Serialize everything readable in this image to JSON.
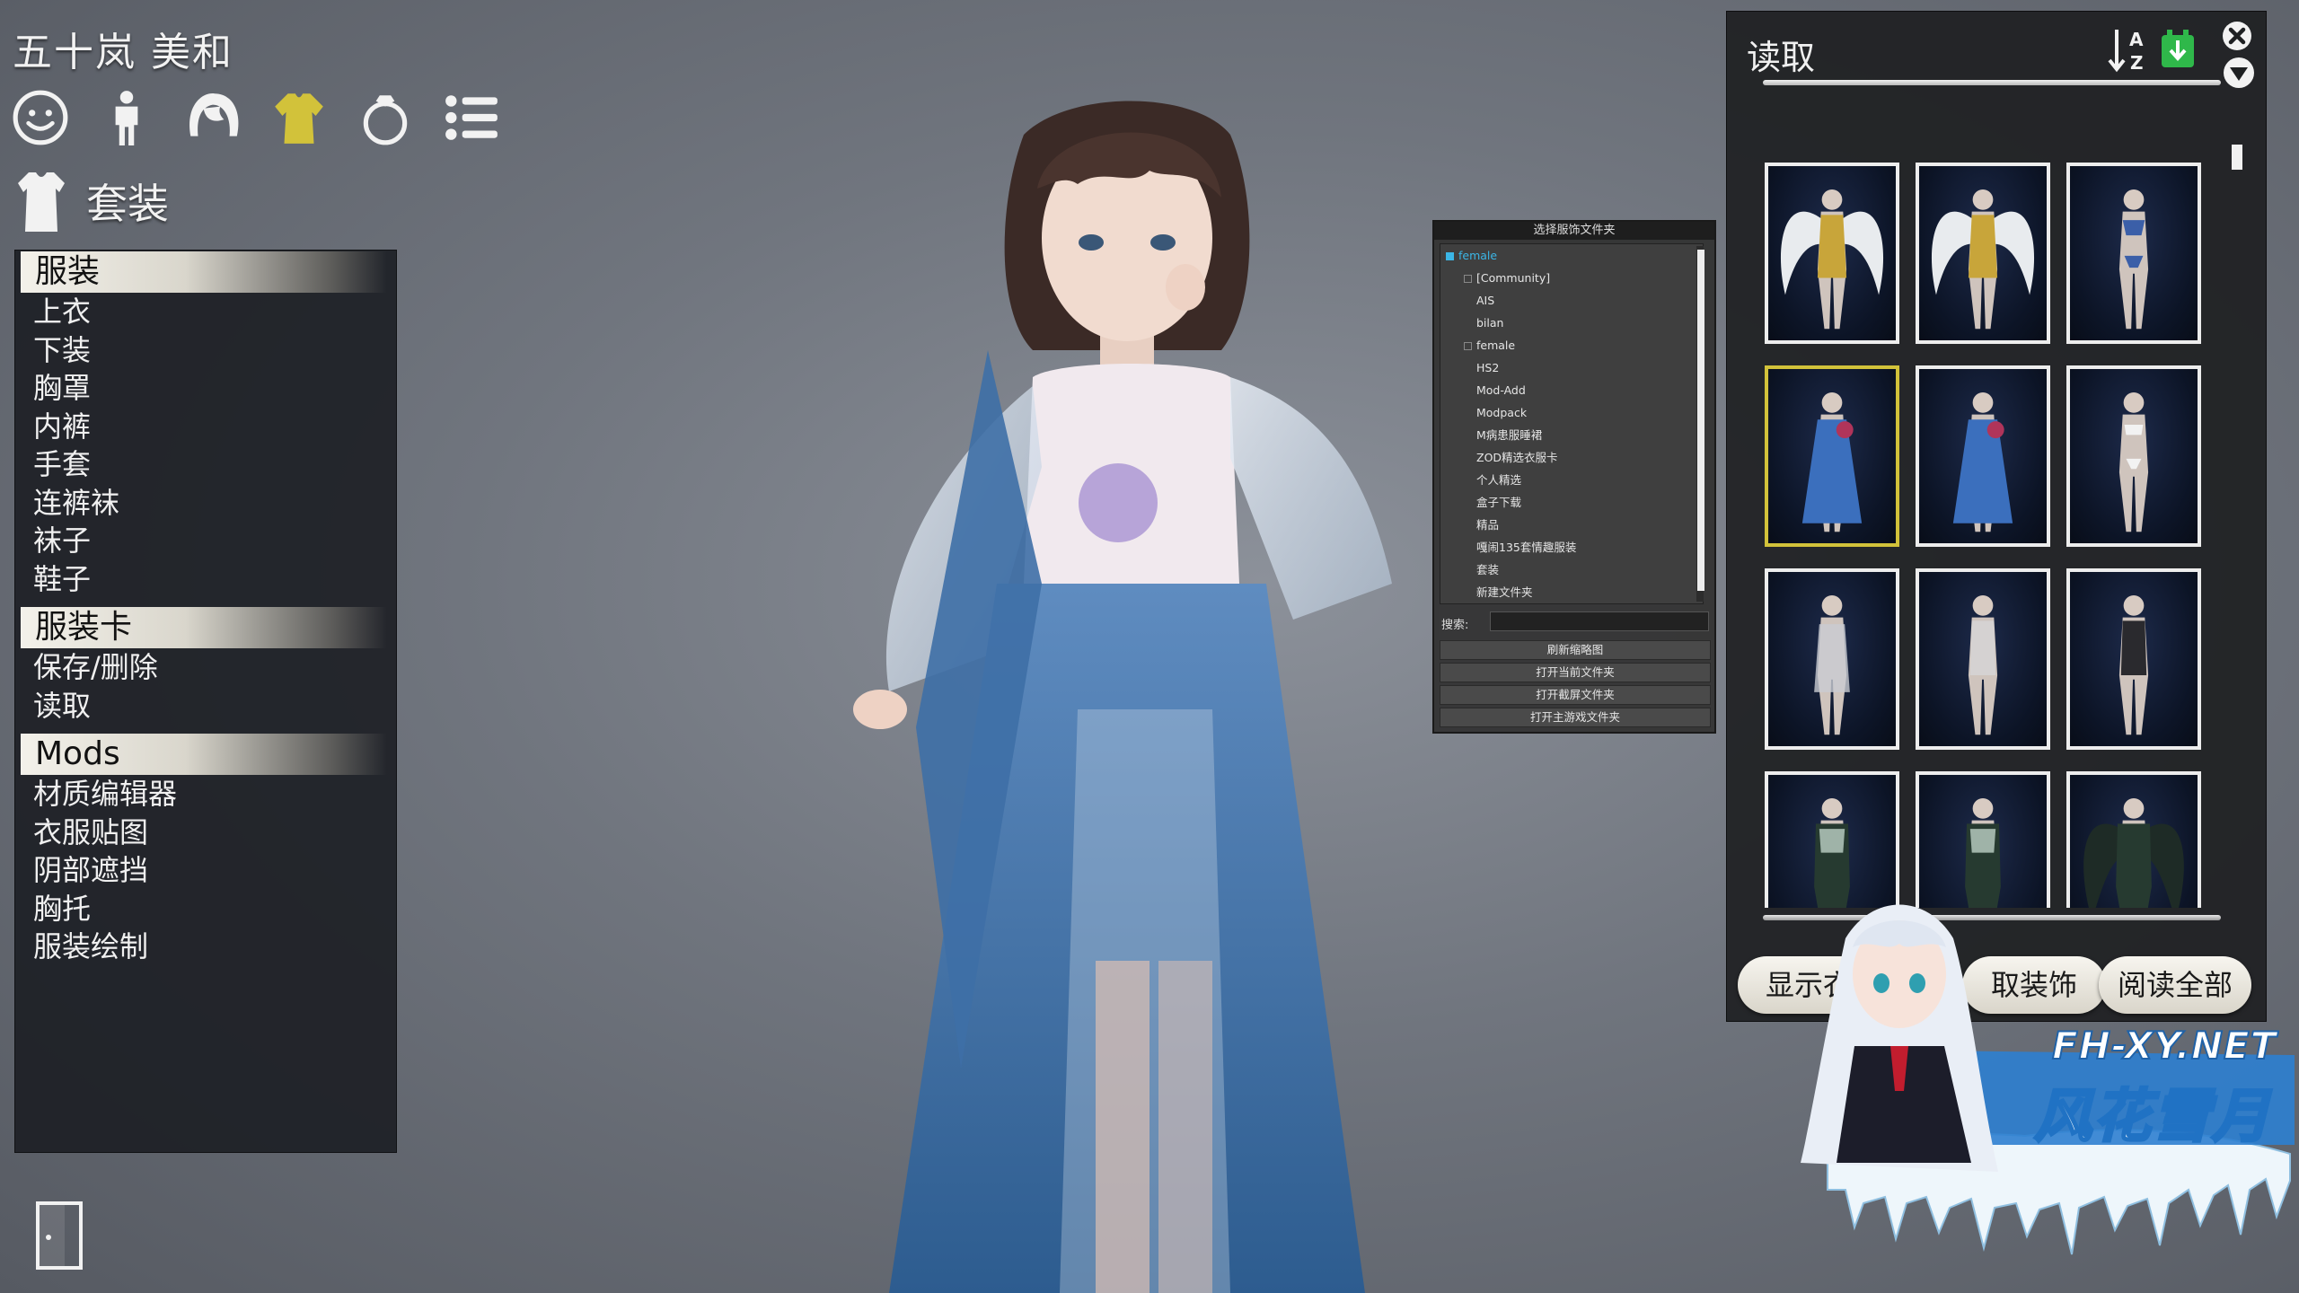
{
  "character": {
    "name": "五十岚 美和"
  },
  "category_icons": [
    {
      "name": "face-icon",
      "active": false
    },
    {
      "name": "body-icon",
      "active": false
    },
    {
      "name": "hair-icon",
      "active": false
    },
    {
      "name": "clothing-icon",
      "active": true
    },
    {
      "name": "accessory-ring-icon",
      "active": false
    },
    {
      "name": "list-icon",
      "active": false
    }
  ],
  "section": {
    "icon": "shirt-icon",
    "title": "套装"
  },
  "menu": {
    "clothing": {
      "header": "服装",
      "items": [
        "上衣",
        "下装",
        "胸罩",
        "内裤",
        "手套",
        "连裤袜",
        "袜子",
        "鞋子"
      ]
    },
    "card": {
      "header": "服装卡",
      "items": [
        "保存/删除",
        "读取"
      ]
    },
    "mods": {
      "header": "Mods",
      "items": [
        "材质编辑器",
        "衣服贴图",
        "阴部遮挡",
        "胸托",
        "服装绘制"
      ]
    }
  },
  "folder_dialog": {
    "title": "选择服饰文件夹",
    "root": "female",
    "folders": [
      {
        "label": "[Community]",
        "level": 1,
        "has_box": true
      },
      {
        "label": "AIS",
        "level": 2,
        "has_box": false
      },
      {
        "label": "bilan",
        "level": 2,
        "has_box": false
      },
      {
        "label": "female",
        "level": 1,
        "has_box": true
      },
      {
        "label": "HS2",
        "level": 2,
        "has_box": false
      },
      {
        "label": "Mod-Add",
        "level": 2,
        "has_box": false
      },
      {
        "label": "Modpack",
        "level": 2,
        "has_box": false
      },
      {
        "label": "M病患服睡裙",
        "level": 2,
        "has_box": false
      },
      {
        "label": "ZOD精选衣服卡",
        "level": 2,
        "has_box": false
      },
      {
        "label": "个人精选",
        "level": 2,
        "has_box": false
      },
      {
        "label": "盒子下载",
        "level": 2,
        "has_box": false
      },
      {
        "label": "精品",
        "level": 2,
        "has_box": false
      },
      {
        "label": "嘎闹135套情趣服装",
        "level": 2,
        "has_box": false
      },
      {
        "label": "套装",
        "level": 2,
        "has_box": false
      },
      {
        "label": "新建文件夹",
        "level": 2,
        "has_box": false
      }
    ],
    "search_label": "搜索:",
    "search_value": "",
    "buttons": [
      "刷新缩略图",
      "打开当前文件夹",
      "打开截屏文件夹",
      "打开主游戏文件夹"
    ]
  },
  "load_panel": {
    "title": "读取",
    "icons": {
      "sort": "sort-az-icon",
      "import": "import-download-icon",
      "close": "close-icon",
      "collapse": "collapse-icon"
    },
    "selected_index": 3,
    "thumbnails": [
      {
        "kind": "wings-gold"
      },
      {
        "kind": "wings-gold"
      },
      {
        "kind": "swimsuit"
      },
      {
        "kind": "blue-dress"
      },
      {
        "kind": "blue-dress"
      },
      {
        "kind": "lingerie"
      },
      {
        "kind": "slip"
      },
      {
        "kind": "bodysuit"
      },
      {
        "kind": "bodysuit-dark"
      },
      {
        "kind": "armor"
      },
      {
        "kind": "armor"
      },
      {
        "kind": "armor-wings"
      }
    ],
    "buttons": [
      "显示衣服",
      "取装饰",
      "阅读全部"
    ]
  },
  "watermark": {
    "domain": "FH-XY.NET",
    "brand": "风花雪月"
  },
  "colors": {
    "accent_selected": "#d2c23a",
    "tree_active": "#3bb6e6",
    "panel_bg": "#1e2022"
  }
}
